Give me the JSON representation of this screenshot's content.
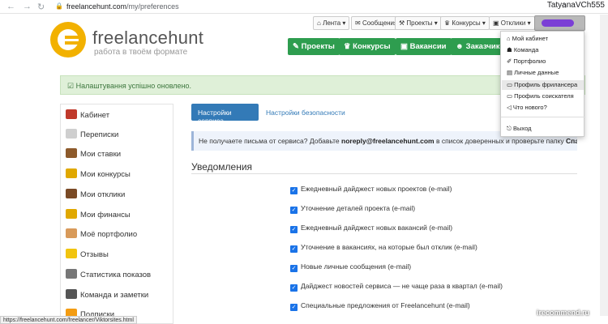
{
  "browser": {
    "url_host": "freelancehunt.com",
    "url_path": "/my/preferences",
    "user": "TatyanaVCh555"
  },
  "logo": {
    "text": "freelancehunt",
    "tagline": "работа в твоём формате"
  },
  "topnav": {
    "feed": "Лента ▾",
    "messages": "Сообщения",
    "projects": "Проекты ▾",
    "contests": "Конкурсы ▾",
    "bids": "Отклики ▾"
  },
  "greennav": {
    "projects": "Проекты",
    "contests": "Конкурсы",
    "vacancies": "Вакансии",
    "clients": "Заказчики"
  },
  "success": "Налаштування успішно оновлено.",
  "sidebar": {
    "items": [
      {
        "label": "Кабинет",
        "color": "#c0392b"
      },
      {
        "label": "Переписки",
        "color": "#bbbbbb"
      },
      {
        "label": "Мои ставки",
        "color": "#8d5a2b"
      },
      {
        "label": "Мои конкурсы",
        "color": "#e0a800"
      },
      {
        "label": "Мои отклики",
        "color": "#7a4a25"
      },
      {
        "label": "Мои финансы",
        "color": "#e0a800"
      },
      {
        "label": "Моё портфолио",
        "color": "#d89a5a"
      },
      {
        "label": "Отзывы",
        "color": "#f1c40f"
      },
      {
        "label": "Статистика показов",
        "color": "#777777"
      },
      {
        "label": "Команда и заметки",
        "color": "#555555"
      },
      {
        "label": "Подписки",
        "color": "#f39c12"
      }
    ]
  },
  "tabs": {
    "active": "Настройки сервиса",
    "other": "Настройки безопасности"
  },
  "info": {
    "pre": "Не получаете письма от сервиса? Добавьте ",
    "email": "noreply@freelancehunt.com",
    "mid": " в список доверенных и проверьте папку ",
    "spam": "Спам",
    "end": "."
  },
  "notifications": {
    "title": "Уведомления",
    "items": [
      "Ежедневный дайджест новых проектов (e-mail)",
      "Уточнение деталей проекта (e-mail)",
      "Ежедневный дайджест новых вакансий (e-mail)",
      "Уточнение в вакансиях, на которые был отклик (e-mail)",
      "Новые личные сообщения (e-mail)",
      "Дайджест новостей сервиса — не чаще раза в квартал (e-mail)",
      "Специальные предложения от Freelancehunt (e-mail)"
    ]
  },
  "dropdown": {
    "items": [
      "Мой кабинет",
      "Команда",
      "Портфолио",
      "Личные данные",
      "Профиль фрилансера",
      "Профиль соискателя",
      "Что нового?"
    ],
    "logout": "Выход"
  },
  "status_url": "https://freelancehunt.com/freelancer/Viktorsites.html",
  "watermark": "irecommend.ru"
}
